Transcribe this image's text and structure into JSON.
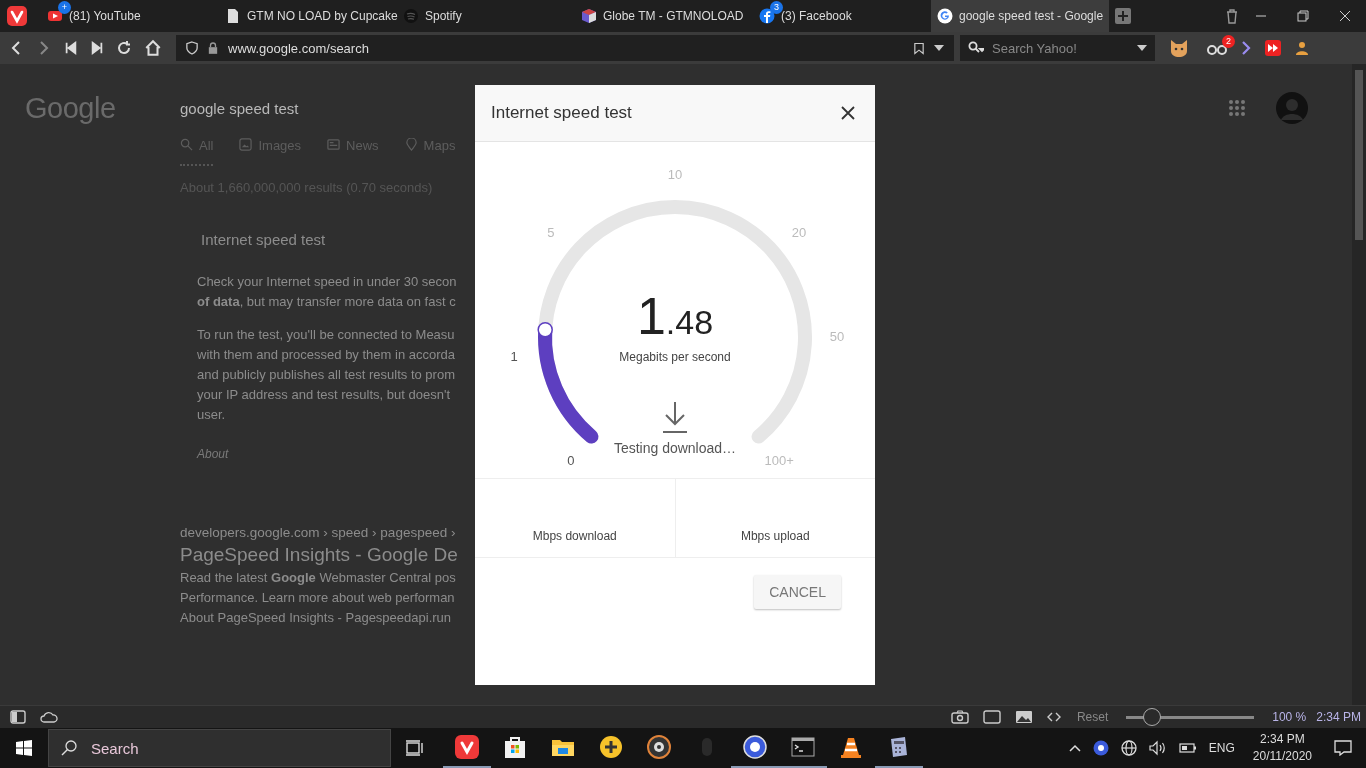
{
  "browser_tabs": [
    {
      "title": "(81) YouTube",
      "kind": "video",
      "badge": "+",
      "selected": false
    },
    {
      "title": "GTM NO LOAD by Cupcake",
      "kind": "document",
      "selected": false
    },
    {
      "title": "Spotify",
      "kind": "music",
      "selected": false
    },
    {
      "title": "Globe TM - GTMNOLOAD",
      "kind": "cube",
      "selected": false
    },
    {
      "title": "(3) Facebook",
      "kind": "social",
      "badge": "3",
      "selected": false
    },
    {
      "title": "google speed test - Google",
      "kind": "google",
      "selected": true
    }
  ],
  "address_bar": {
    "url": "www.google.com/search"
  },
  "search_field": {
    "placeholder": "Search Yahoo!"
  },
  "extension_badge": "2",
  "page": {
    "logo": "Google",
    "query": "google speed test",
    "nav_tabs": [
      {
        "label": "All",
        "kind": "search",
        "selected": true
      },
      {
        "label": "Images",
        "kind": "image",
        "selected": false
      },
      {
        "label": "News",
        "kind": "news",
        "selected": false
      },
      {
        "label": "Maps",
        "kind": "pin",
        "selected": false
      }
    ],
    "results_count": "About 1,660,000,000 results (0.70 seconds)",
    "card": {
      "title": "Internet speed test",
      "paragraphs": [
        [
          "Check your Internet speed in under 30 secon",
          "**of data**, but may transfer more data on fast c"
        ],
        [
          "To run the test, you'll be connected to Measu",
          "with them and processed by them in accorda",
          "and publicly publishes all test results to prom",
          "your IP address and test results, but doesn't",
          "user."
        ]
      ],
      "about": "About"
    },
    "result": {
      "breadcrumb": "developers.google.com › speed › pagespeed ›",
      "title": "PageSpeed Insights - Google De",
      "snippet": [
        "Read the latest **Google** Webmaster Central pos",
        "Performance. Learn more about web performan",
        "About PageSpeed Insights - Pagespeedapi.run"
      ]
    }
  },
  "dialog": {
    "title": "Internet speed test",
    "gauge": {
      "ticks": [
        "0",
        "1",
        "5",
        "10",
        "20",
        "50",
        "100+"
      ],
      "level": 0.19
    },
    "speed_whole": "1",
    "speed_fraction": ".48",
    "unit": "Megabits per second",
    "status": "Testing download…",
    "results": [
      {
        "label": "Mbps download"
      },
      {
        "label": "Mbps upload"
      }
    ],
    "cancel": "CANCEL"
  },
  "status_bar": {
    "reset": "Reset",
    "zoom": {
      "level": 0.2
    },
    "zoom_reading": "100 %",
    "time": "2:34 PM"
  },
  "taskbar": {
    "search_placeholder": "Search",
    "apps": [
      {
        "kind": "vivaldi",
        "running": true
      },
      {
        "kind": "store",
        "running": false
      },
      {
        "kind": "folder",
        "running": false
      },
      {
        "kind": "game",
        "running": false
      },
      {
        "kind": "disc",
        "running": false
      },
      {
        "kind": "mouse",
        "running": false
      },
      {
        "kind": "hpf",
        "running": true
      },
      {
        "kind": "terminal",
        "running": true
      },
      {
        "kind": "cone",
        "running": false
      },
      {
        "kind": "calculator",
        "running": true
      }
    ],
    "language": "ENG",
    "time": "2:34 PM",
    "date": "20/11/2020"
  }
}
